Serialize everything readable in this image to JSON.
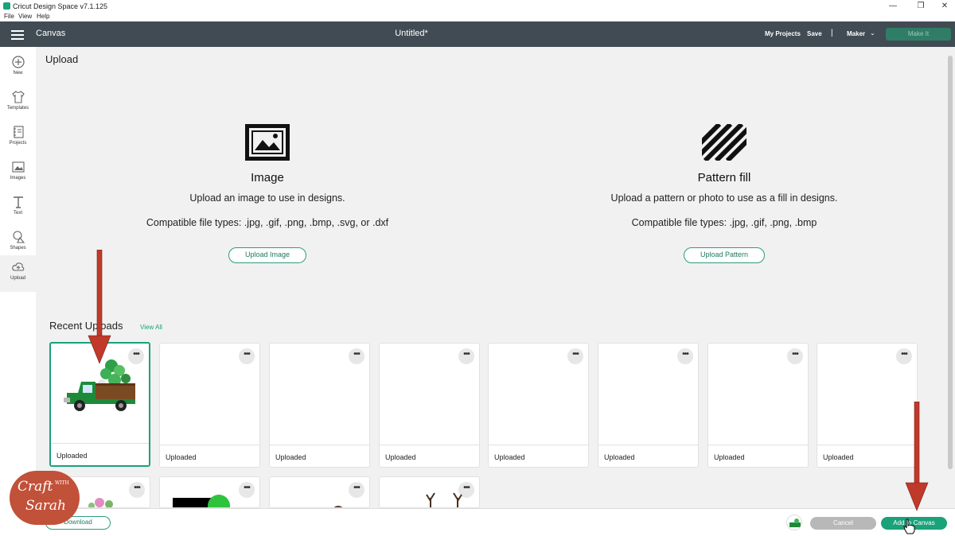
{
  "window": {
    "title": "Cricut Design Space  v7.1.125",
    "menu": [
      "File",
      "View",
      "Help"
    ],
    "controls": {
      "minimize": "—",
      "maximize": "❐",
      "close": "✕"
    }
  },
  "header": {
    "section": "Canvas",
    "doc_title": "Untitled*",
    "my_projects": "My Projects",
    "save": "Save",
    "separator": "|",
    "machine": "Maker",
    "make_it": "Make It"
  },
  "sidebar": {
    "items": [
      {
        "label": "New",
        "icon": "plus-circle-icon"
      },
      {
        "label": "Templates",
        "icon": "tshirt-icon"
      },
      {
        "label": "Projects",
        "icon": "projects-icon"
      },
      {
        "label": "Images",
        "icon": "image-icon"
      },
      {
        "label": "Text",
        "icon": "text-icon"
      },
      {
        "label": "Shapes",
        "icon": "shapes-icon"
      },
      {
        "label": "Upload",
        "icon": "cloud-upload-icon"
      }
    ],
    "active": "Upload"
  },
  "main": {
    "title": "Upload",
    "image_block": {
      "heading": "Image",
      "description": "Upload an image to use in designs.",
      "types": "Compatible file types: .jpg, .gif, .png, .bmp, .svg, or .dxf",
      "button": "Upload Image"
    },
    "pattern_block": {
      "heading": "Pattern fill",
      "description": "Upload a pattern or photo to use as a fill in designs.",
      "types": "Compatible file types: .jpg, .gif, .png, .bmp",
      "button": "Upload Pattern"
    },
    "recent_title": "Recent Uploads",
    "view_all": "View All",
    "uploads": [
      {
        "label": "Uploaded",
        "thumb": "green truck with shamrocks",
        "selected": true
      },
      {
        "label": "Uploaded",
        "thumb": "blank",
        "selected": false
      },
      {
        "label": "Uploaded",
        "thumb": "blank",
        "selected": false
      },
      {
        "label": "Uploaded",
        "thumb": "blank",
        "selected": false
      },
      {
        "label": "Uploaded",
        "thumb": "blank",
        "selected": false
      },
      {
        "label": "Uploaded",
        "thumb": "blank",
        "selected": false
      },
      {
        "label": "Uploaded",
        "thumb": "blank",
        "selected": false
      },
      {
        "label": "Uploaded",
        "thumb": "blank",
        "selected": false
      }
    ],
    "more_label": "•••"
  },
  "footer": {
    "download": "Download",
    "cancel": "Cancel",
    "add_to_canvas": "Add to Canvas"
  },
  "watermark": {
    "line1": "Craft",
    "with": "WITH",
    "line2": "Sarah"
  },
  "colors": {
    "accent": "#1aa27a",
    "header": "#414b53",
    "arrow": "#c0392b"
  }
}
